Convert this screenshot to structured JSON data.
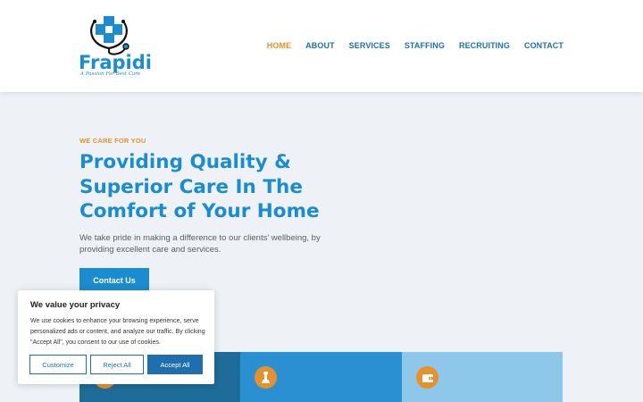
{
  "brand": {
    "name": "Frapidi",
    "tagline": "A Passion For Best Care"
  },
  "nav": {
    "items": [
      {
        "label": "HOME",
        "active": true
      },
      {
        "label": "ABOUT",
        "active": false
      },
      {
        "label": "SERVICES",
        "active": false
      },
      {
        "label": "STAFFING",
        "active": false
      },
      {
        "label": "RECRUITING",
        "active": false
      },
      {
        "label": "CONTACT",
        "active": false
      }
    ]
  },
  "hero": {
    "eyebrow": "WE CARE FOR YOU",
    "title": "Providing Quality & Superior Care In The Comfort of Your Home",
    "text": "We take pride in making a difference to our clients' wellbeing, by providing excellent care and services.",
    "cta": "Contact Us"
  },
  "cards": [
    {
      "icon": "care-icon"
    },
    {
      "icon": "chess-piece-icon"
    },
    {
      "icon": "wallet-icon"
    }
  ],
  "cookie": {
    "title": "We value your privacy",
    "text": "We use cookies to enhance your browsing experience, serve personalized ads or content, and analyze our traffic. By clicking \"Accept All\", you consent to our use of cookies.",
    "buttons": {
      "customize": "Customize",
      "reject": "Reject All",
      "accept": "Accept All"
    }
  },
  "colors": {
    "primary": "#1a8ccf",
    "accent": "#e8902a",
    "navy": "#1f6fae"
  }
}
